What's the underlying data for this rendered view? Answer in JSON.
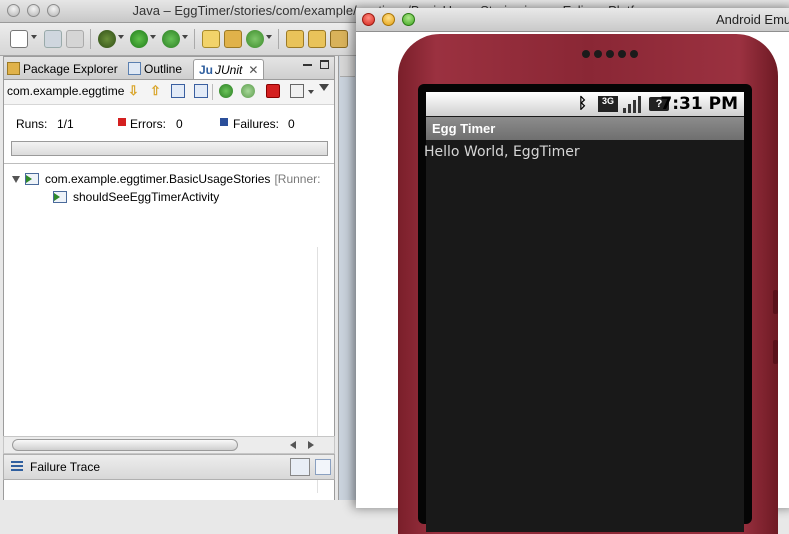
{
  "eclipse": {
    "window_title": "Java – EggTimer/stories/com/example/eggtimer/BasicUsageStories.java – Eclipse Platform",
    "view_tabs": [
      "Package Explorer",
      "Outline",
      "JUnit"
    ],
    "junit_tab_prefix": "Ju",
    "session_label": "com.example.eggtimer.BasicUsageStories",
    "runs_label": "Runs:",
    "runs_value": "1/1",
    "errors_label": "Errors:",
    "errors_value": "0",
    "failures_label": "Failures:",
    "failures_value": "0",
    "tree": {
      "suite_label": "com.example.eggtimer.BasicUsageStories",
      "suite_runner": "[Runner:",
      "test_label": "shouldSeeEggTimerActivity"
    },
    "failure_trace_label": "Failure Trace"
  },
  "emulator": {
    "window_title": "Android Emulator",
    "status_clock": "7:31 PM",
    "app_title": "Egg Timer",
    "hello_text": "Hello World, EggTimer",
    "network_badge": "3G",
    "colors": {
      "phone_body": "#8a2735",
      "app_bg": "#191919"
    }
  }
}
